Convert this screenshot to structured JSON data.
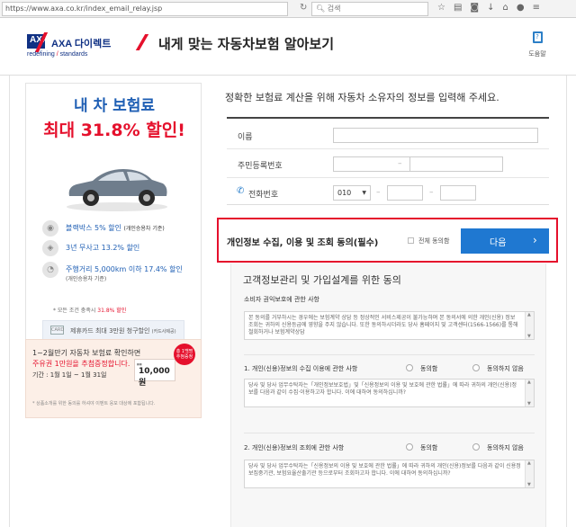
{
  "browser": {
    "url": "https://www.axa.co.kr/index_email_relay.jsp",
    "search_placeholder": "검색"
  },
  "header": {
    "brand_name": "AXA 다이렉트",
    "logo_text": "AXA",
    "tagline_a": "redefining",
    "tagline_b": "standards",
    "page_title": "내게 맞는 자동차보험 알아보기",
    "help_label": "도움말"
  },
  "ad": {
    "headline1": "내 차 보험료",
    "headline2": "최대 31.8% 할인!",
    "benefits": [
      {
        "text": "블랙박스 5% 할인",
        "note": "(개인승용차 기준)"
      },
      {
        "text": "3년 무사고 13.2% 할인",
        "note": ""
      },
      {
        "text": "주행거리 5,000km 이하 17.4% 할인",
        "sub": "(개인승용차 기준)"
      }
    ],
    "condition_a": "* 모든 조건 충족시",
    "condition_b": "31.8% 할인",
    "card_offer": "제휴카드 최대 3만원 청구할인",
    "card_note": "(카드사제공)",
    "promo_a": "1~2월만기 자동차 보험료 확인하면",
    "promo_b": "주유권 1만원을 추첨증정합니다.",
    "promo_c": "기간 : 1월 1일 ~ 1월 31일",
    "promo_d": "* 상품소개를 위한 동의를 하셔야 이벤트 응모 대상에 포함됩니다.",
    "coupon_value": "10,000원",
    "seal_text": "총 1백명 추첨증정"
  },
  "form": {
    "intro": "정확한 보험료 계산을 위해 자동차 소유자의 정보를 입력해 주세요.",
    "name_label": "이름",
    "rrn_label": "주민등록번호",
    "phone_label": "전화번호",
    "phone_prefix": "010"
  },
  "consent": {
    "title": "개인정보 수집, 이용 및 조회 동의(필수)",
    "agree_all": "전체 동의함",
    "next_label": "다음"
  },
  "panel": {
    "title": "고객정보관리 및 가입설계를 위한 동의",
    "subtitle": "소비자 권익보호에 관한 사항",
    "text1": "본 동의를 거부하시는 경우에는 보험계약 상담 등 정상적인 서비스제공이 불가능하며 본 동의서에 의한 개인(신용) 정보 조회는 귀하의 신용등급에 영향을 주지 않습니다. 또한 동의하시더라도 당사 홈페이지 및 고객센터(1566-1566)를 통해 철회하거나 보험계약상담",
    "section1": "1. 개인(신용)정보의 수집 이용에 관한 사항",
    "section2": "2. 개인(신용)정보의 조회에 관한 사항",
    "agree": "동의함",
    "disagree": "동의하지 않음",
    "text2": "당사 및 당사 업무수탁자는「개인정보보호법」및「신용정보의 이용 및 보호에 관한 법률」에 따라 귀하의 개인(신용)정보를 다음과 같이 수집·이용하고자 합니다. 이에 대하여 동의하십니까?",
    "text3": "당사 및 당사 업무수탁자는「신용정보의 이용 및 보호에 관한 법률」에 따라 귀하의 개인(신용)정보를 다음과 같이 신용정보집중기관, 보험요율산출기관 등으로부터 조회하고자 합니다. 이에 대하여 동의하십니까?"
  }
}
